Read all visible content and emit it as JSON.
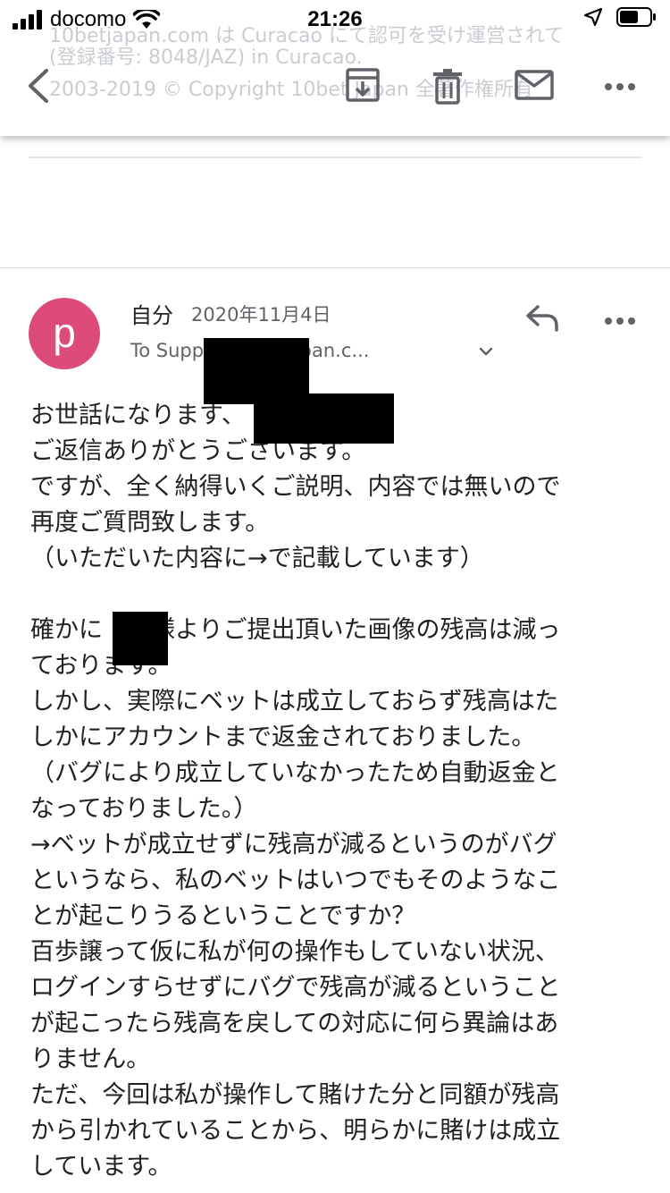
{
  "status_bar": {
    "carrier": "docomo",
    "time": "21:26"
  },
  "toolbar": {
    "ghost_line_1": "10betjapan.com は Curacao にて認可を受け運営されて",
    "ghost_line_1b": "(登録番号: 8048/JAZ) in Curacao.",
    "ghost_line_2": "2003-2019 © Copyright 10bet Japan 全著作権所有"
  },
  "message": {
    "avatar_letter": "p",
    "sender": "自分",
    "date": "2020年11月4日",
    "recipient": "To Supp               @10betjapan.c...",
    "body_lines": [
      "お世話になります、",
      "ご返信ありがとうございます。",
      "ですが、全く納得いくご説明、内容では無いので",
      "再度ご質問致します。",
      "（いただいた内容に→で記載しています）",
      "",
      "確かに　　様よりご提出頂いた画像の残高は減っ",
      "ております。",
      "しかし、実際にベットは成立しておらず残高はた",
      "しかにアカウントまで返金されておりました。",
      "（バグにより成立していなかったため自動返金と",
      "なっておりました。）",
      "→ベットが成立せずに残高が減るというのがバグ",
      "というなら、私のベットはいつでもそのようなこ",
      "とが起こりうるということですか？",
      "百歩譲って仮に私が何の操作もしていない状況、",
      "ログインすらせずにバグで残高が減るということ",
      "が起こったら残高を戻しての対応に何ら異論はあ",
      "りません。",
      "ただ、今回は私が操作して賭けた分と同額が残高",
      "から引かれていることから、明らかに賭けは成立",
      "しています。"
    ]
  }
}
